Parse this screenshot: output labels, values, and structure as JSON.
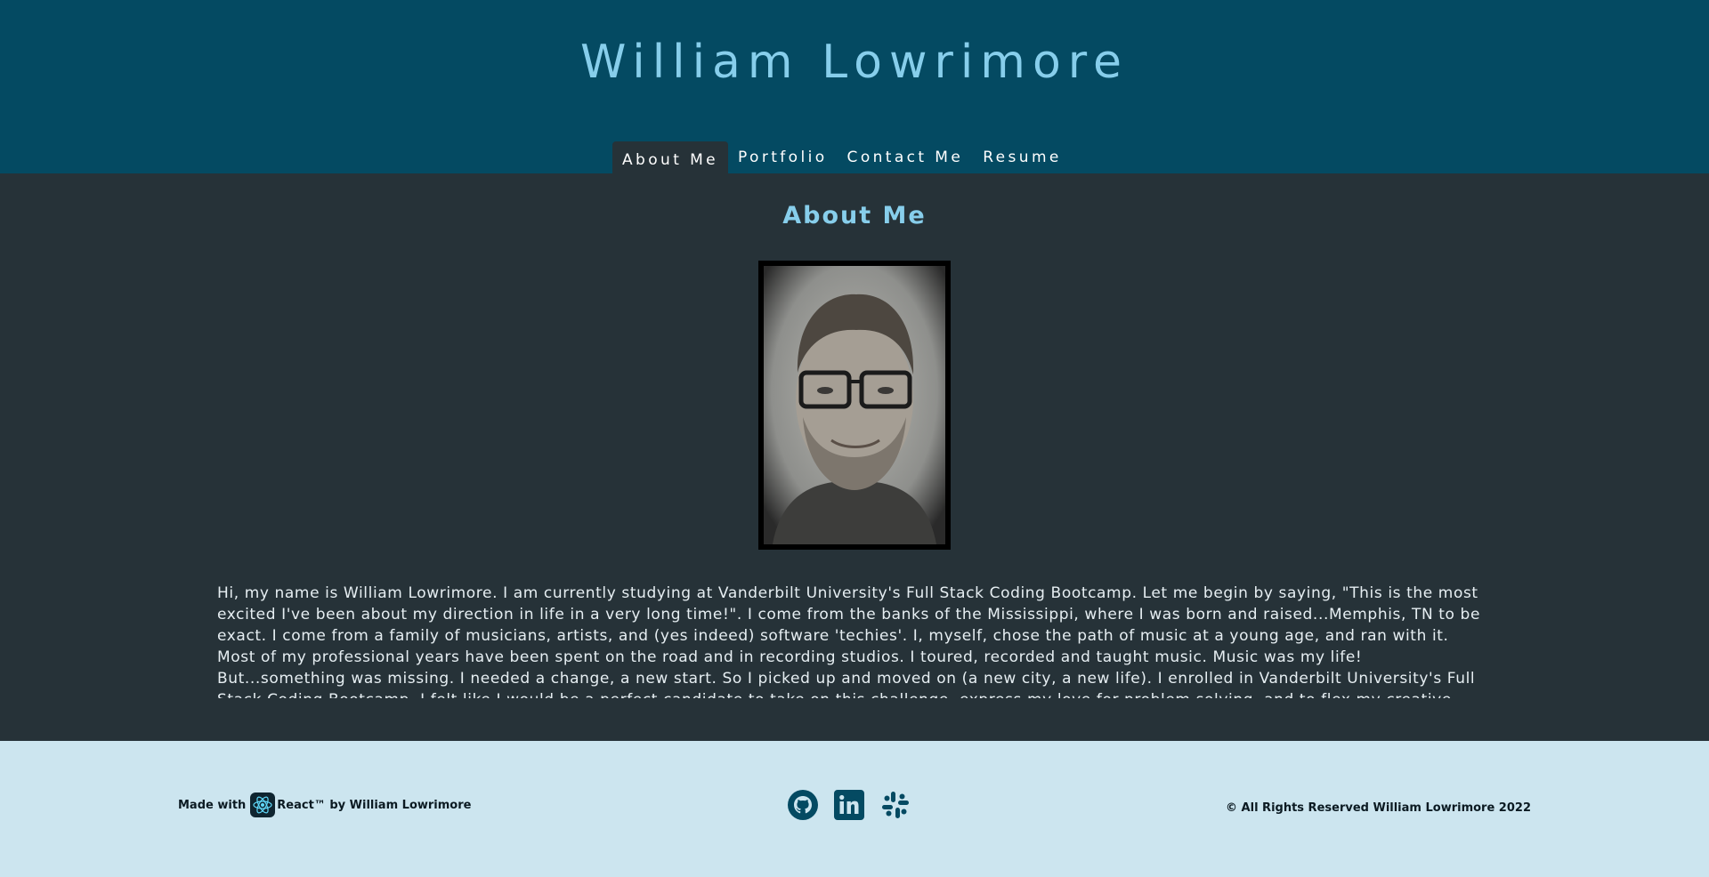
{
  "header": {
    "title": "William Lowrimore",
    "nav": [
      {
        "label": "About Me",
        "active": true
      },
      {
        "label": "Portfolio",
        "active": false
      },
      {
        "label": "Contact Me",
        "active": false
      },
      {
        "label": "Resume",
        "active": false
      }
    ]
  },
  "main": {
    "section_title": "About Me",
    "bio": "Hi, my name is William Lowrimore. I am currently studying at Vanderbilt University's Full Stack Coding Bootcamp. Let me begin by saying, \"This is the most excited I've been about my direction in life in a very long time!\". I come from the banks of the Mississippi, where I was born and raised...Memphis, TN to be exact. I come from a family of musicians, artists, and (yes indeed) software 'techies'. I, myself, chose the path of music at a young age, and ran with it. Most of my professional years have been spent on the road and in recording studios. I toured, recorded and taught music. Music was my life! But...something was missing. I needed a change, a new start. So I picked up and moved on (a new city, a new life). I enrolled in Vanderbilt University's Full Stack Coding Bootcamp. I felt like I would be a perfect candidate to take on this challenge, express my love for problem solving, and to flex my creative muscles. I've enjoyed every"
  },
  "footer": {
    "made_with": "Made with",
    "react_suffix": "React™ by William Lowrimore",
    "copyright": "© All Rights Reserved William Lowrimore 2022",
    "social_icons": [
      "github-icon",
      "linkedin-icon",
      "slack-icon"
    ]
  },
  "colors": {
    "header_bg": "#044a62",
    "content_bg": "#263238",
    "footer_bg": "#cce5ef",
    "accent": "#87ceeb",
    "icon": "#044a62"
  }
}
